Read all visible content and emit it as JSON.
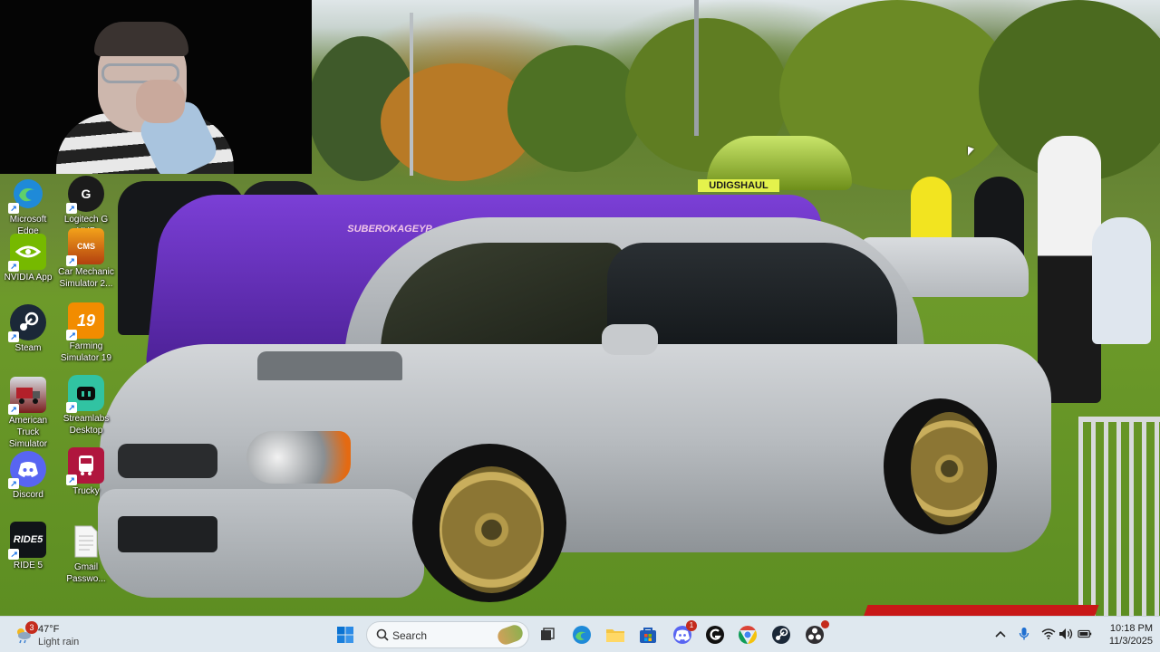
{
  "desktop": {
    "icons": [
      {
        "label": "Microsoft Edge",
        "icon": "edge-icon",
        "color": "#1a73c8"
      },
      {
        "label": "Logitech G HUB",
        "icon": "logitech-g-hub-icon",
        "color": "#1b1b1b"
      },
      {
        "label": "NVIDIA App",
        "icon": "nvidia-icon",
        "color": "#76b900"
      },
      {
        "label": "Car Mechanic Simulator 2...",
        "icon": "car-mechanic-simulator-icon",
        "color": "#e07a10"
      },
      {
        "label": "Steam",
        "icon": "steam-icon",
        "color": "#1b2838"
      },
      {
        "label": "Farming Simulator 19",
        "icon": "farming-simulator-icon",
        "color": "#f28c00"
      },
      {
        "label": "American Truck Simulator",
        "icon": "american-truck-simulator-icon",
        "color": "#7a1e1e"
      },
      {
        "label": "Streamlabs Desktop",
        "icon": "streamlabs-icon",
        "color": "#31c3a2"
      },
      {
        "label": "Discord",
        "icon": "discord-icon",
        "color": "#5865f2"
      },
      {
        "label": "Trucky",
        "icon": "trucky-icon",
        "color": "#b0163e"
      },
      {
        "label": "RIDE 5",
        "icon": "ride5-icon",
        "color": "#101418"
      },
      {
        "label": "Gmail Passwo...",
        "icon": "text-document-icon",
        "color": "#f4f4f4"
      }
    ]
  },
  "wallpaper": {
    "plate_text": "UDIGSHAUL",
    "sticker_text": "SUBEROKAGEYP"
  },
  "taskbar": {
    "weather": {
      "temp": "47°F",
      "condition": "Light rain",
      "badge": "3"
    },
    "search_label": "Search",
    "apps": [
      {
        "name": "start-button",
        "icon": "windows-icon"
      },
      {
        "name": "task-view-button",
        "icon": "task-view-icon"
      },
      {
        "name": "edge-taskbar",
        "icon": "edge-icon"
      },
      {
        "name": "file-explorer-taskbar",
        "icon": "folder-icon"
      },
      {
        "name": "microsoft-store-taskbar",
        "icon": "store-icon"
      },
      {
        "name": "discord-taskbar",
        "icon": "discord-icon",
        "badge": "1"
      },
      {
        "name": "logitech-taskbar",
        "icon": "logitech-g-hub-icon"
      },
      {
        "name": "chrome-taskbar",
        "icon": "chrome-icon"
      },
      {
        "name": "steam-taskbar",
        "icon": "steam-icon"
      },
      {
        "name": "obs-taskbar",
        "icon": "obs-icon"
      }
    ],
    "clock": {
      "time": "10:18 PM",
      "date": "11/3/2025"
    }
  }
}
